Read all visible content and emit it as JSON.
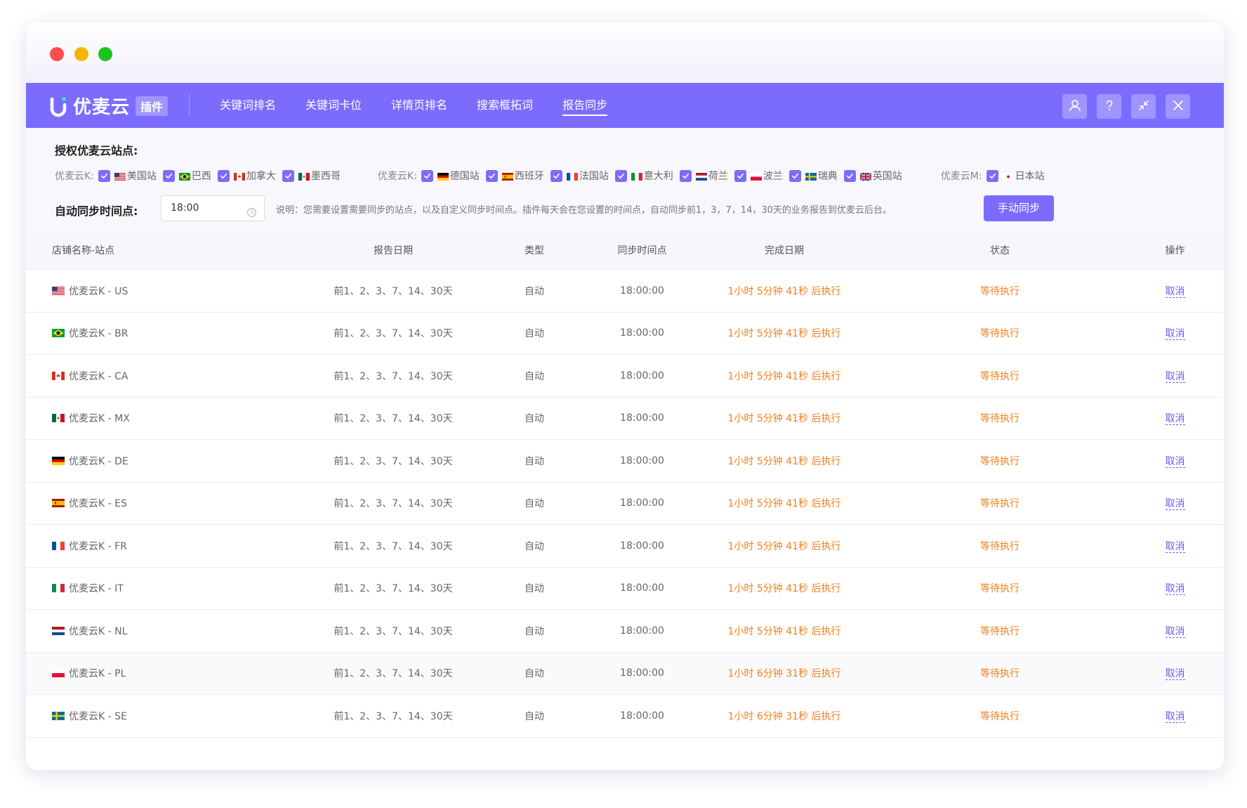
{
  "brand": {
    "name": "优麦云",
    "badge": "插件"
  },
  "nav": {
    "tabs": [
      {
        "label": "关键词排名"
      },
      {
        "label": "关键词卡位"
      },
      {
        "label": "详情页排名"
      },
      {
        "label": "搜索框拓词"
      },
      {
        "label": "报告同步"
      }
    ],
    "active": "报告同步",
    "actions": [
      "user-icon",
      "help-icon",
      "minimize-icon",
      "close-icon"
    ]
  },
  "settings": {
    "title": "授权优麦云站点:",
    "groups": [
      {
        "label": "优麦云K:",
        "sites": [
          {
            "name": "美国站",
            "flag": "us",
            "checked": true
          },
          {
            "name": "巴西",
            "flag": "br",
            "checked": true
          },
          {
            "name": "加拿大",
            "flag": "ca",
            "checked": true
          },
          {
            "name": "墨西哥",
            "flag": "mx",
            "checked": true
          }
        ]
      },
      {
        "label": "优麦云K:",
        "sites": [
          {
            "name": "德国站",
            "flag": "de",
            "checked": true
          },
          {
            "name": "西班牙",
            "flag": "es",
            "checked": true
          },
          {
            "name": "法国站",
            "flag": "fr",
            "checked": true
          },
          {
            "name": "意大利",
            "flag": "it",
            "checked": true
          },
          {
            "name": "荷兰",
            "flag": "nl",
            "checked": true
          },
          {
            "name": "波兰",
            "flag": "pl",
            "checked": true
          },
          {
            "name": "瑞典",
            "flag": "se",
            "checked": true
          },
          {
            "name": "英国站",
            "flag": "gb",
            "checked": true
          }
        ]
      },
      {
        "label": "优麦云M:",
        "sites": [
          {
            "name": "日本站",
            "flag": "jp",
            "checked": true
          }
        ]
      }
    ],
    "sync_label": "自动同步时间点:",
    "sync_time": "18:00",
    "note": "说明：您需要设置需要同步的站点，以及自定义同步时间点。插件每天会在您设置的时间点，自动同步前1，3，7，14，30天的业务报告到优麦云后台。",
    "sync_button": "手动同步"
  },
  "table": {
    "headers": [
      "店铺名称-站点",
      "报告日期",
      "类型",
      "同步时间点",
      "完成日期",
      "状态",
      "操作"
    ],
    "rows": [
      {
        "store": "优麦云K - US",
        "flag": "us",
        "date": "前1、2、3、7、14、30天",
        "type": "自动",
        "time": "18:00:00",
        "done": "1小时 5分钟 41秒 后执行",
        "status": "等待执行",
        "op": "取消"
      },
      {
        "store": "优麦云K - BR",
        "flag": "br",
        "date": "前1、2、3、7、14、30天",
        "type": "自动",
        "time": "18:00:00",
        "done": "1小时 5分钟 41秒 后执行",
        "status": "等待执行",
        "op": "取消"
      },
      {
        "store": "优麦云K - CA",
        "flag": "ca",
        "date": "前1、2、3、7、14、30天",
        "type": "自动",
        "time": "18:00:00",
        "done": "1小时 5分钟 41秒 后执行",
        "status": "等待执行",
        "op": "取消"
      },
      {
        "store": "优麦云K - MX",
        "flag": "mx",
        "date": "前1、2、3、7、14、30天",
        "type": "自动",
        "time": "18:00:00",
        "done": "1小时 5分钟 41秒 后执行",
        "status": "等待执行",
        "op": "取消"
      },
      {
        "store": "优麦云K - DE",
        "flag": "de",
        "date": "前1、2、3、7、14、30天",
        "type": "自动",
        "time": "18:00:00",
        "done": "1小时 5分钟 41秒 后执行",
        "status": "等待执行",
        "op": "取消"
      },
      {
        "store": "优麦云K - ES",
        "flag": "es",
        "date": "前1、2、3、7、14、30天",
        "type": "自动",
        "time": "18:00:00",
        "done": "1小时 5分钟 41秒 后执行",
        "status": "等待执行",
        "op": "取消"
      },
      {
        "store": "优麦云K - FR",
        "flag": "fr",
        "date": "前1、2、3、7、14、30天",
        "type": "自动",
        "time": "18:00:00",
        "done": "1小时 5分钟 41秒 后执行",
        "status": "等待执行",
        "op": "取消"
      },
      {
        "store": "优麦云K - IT",
        "flag": "it",
        "date": "前1、2、3、7、14、30天",
        "type": "自动",
        "time": "18:00:00",
        "done": "1小时 5分钟 41秒 后执行",
        "status": "等待执行",
        "op": "取消"
      },
      {
        "store": "优麦云K - NL",
        "flag": "nl",
        "date": "前1、2、3、7、14、30天",
        "type": "自动",
        "time": "18:00:00",
        "done": "1小时 5分钟 41秒 后执行",
        "status": "等待执行",
        "op": "取消"
      },
      {
        "store": "优麦云K - PL",
        "flag": "pl",
        "date": "前1、2、3、7、14、30天",
        "type": "自动",
        "time": "18:00:00",
        "done": "1小时 6分钟 31秒 后执行",
        "status": "等待执行",
        "op": "取消"
      },
      {
        "store": "优麦云K - SE",
        "flag": "se",
        "date": "前1、2、3、7、14、30天",
        "type": "自动",
        "time": "18:00:00",
        "done": "1小时 6分钟 31秒 后执行",
        "status": "等待执行",
        "op": "取消"
      }
    ]
  },
  "colors": {
    "accent": "#7b6cff",
    "warning": "#f07f1b",
    "link": "#6b5cf0"
  }
}
